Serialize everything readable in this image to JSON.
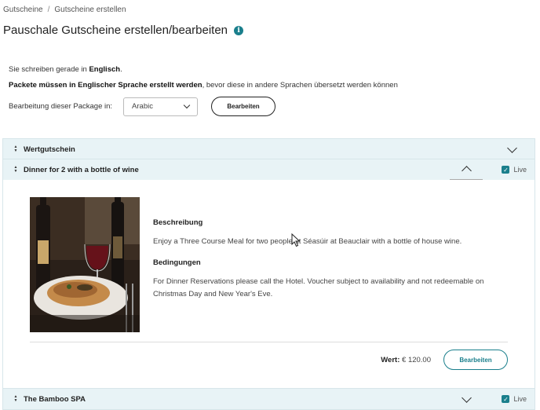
{
  "breadcrumb": {
    "item1": "Gutscheine",
    "separator": "/",
    "item2": "Gutscheine erstellen"
  },
  "page_title": "Pauschale Gutscheine erstellen/bearbeiten",
  "info_icon_glyph": "i",
  "language": {
    "prefix": "Sie schreiben gerade in ",
    "lang": "Englisch",
    "suffix": "."
  },
  "packets_note": {
    "bold": "Packete müssen in Englischer Sprache erstellt werden",
    "rest": ", bevor diese in andere Sprachen übersetzt werden können"
  },
  "edit_language": {
    "label": "Bearbeitung dieser Package in:",
    "selected": "Arabic",
    "button": "Bearbeiten"
  },
  "accordions": [
    {
      "title": "Wertgutschein",
      "expanded": false
    },
    {
      "title": "Dinner for 2 with a bottle of wine",
      "expanded": true,
      "live_label": "Live",
      "live_checked": true,
      "description_heading": "Beschreibung",
      "description": "Enjoy a Three Course Meal for two people at Séasúir at Beauclair with a bottle of house wine.",
      "conditions_heading": "Bedingungen",
      "conditions": "For Dinner Reservations please call the Hotel. Voucher subject to availability and not redeemable on Christmas Day and New Year's Eve.",
      "value_label": "Wert:",
      "value": "€ 120.00",
      "edit_button": "Bearbeiten"
    },
    {
      "title": "The Bamboo SPA",
      "expanded": false,
      "live_label": "Live",
      "live_checked": true
    }
  ],
  "colors": {
    "accent": "#1a7f8c",
    "header_bg": "#e8f3f6"
  },
  "icons": {
    "sort": "sort-arrows-icon",
    "chevron": "chevron-icon",
    "check": "✓"
  }
}
